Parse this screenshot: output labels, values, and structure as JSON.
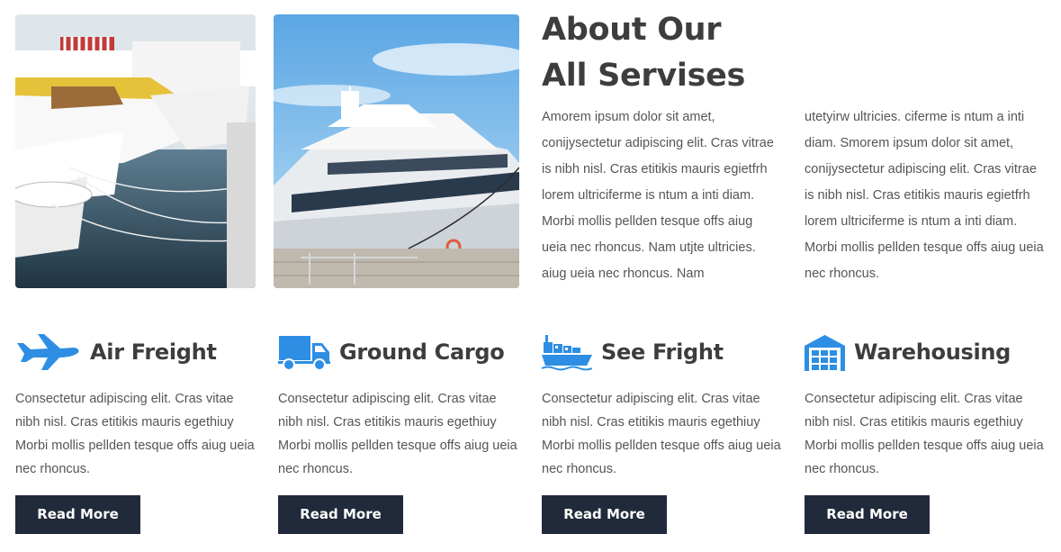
{
  "about": {
    "title_line1": "About Our",
    "title_line2": "All Servises",
    "column1": "Amorem ipsum dolor sit amet, conijysectetur adipiscing elit. Cras vitrae is nibh nisl. Cras etitikis mauris egietfrh lorem ultriciferme is ntum a inti diam. Morbi mollis pellden tesque offs aiug ueia nec rhoncus. Nam utjte ultricies. aiug ueia nec rhoncus. Nam",
    "column2": "utetyirw ultricies. ciferme is ntum a inti diam. Smorem ipsum dolor sit amet, conijysectetur adipiscing elit. Cras vitrae is nibh nisl. Cras etitikis mauris egietfrh lorem ultriciferme is ntum a inti diam. Morbi mollis pellden tesque offs aiug ueia nec rhoncus."
  },
  "images": {
    "photo1": "marina-boats-photo",
    "photo2": "yacht-at-dock-photo"
  },
  "colors": {
    "accent": "#2d8ee3",
    "heading": "#3d3d3d",
    "button": "#212a3a",
    "text": "#555555"
  },
  "services": [
    {
      "icon": "airplane-icon",
      "title": "Air Freight",
      "description": "Consectetur adipiscing elit. Cras vitae nibh nisl. Cras etitikis mauris egethiuy Morbi mollis pellden tesque offs aiug ueia nec rhoncus.",
      "button": "Read More"
    },
    {
      "icon": "truck-icon",
      "title": "Ground Cargo",
      "description": "Consectetur adipiscing elit. Cras vitae nibh nisl. Cras etitikis mauris egethiuy Morbi mollis pellden tesque offs aiug ueia nec rhoncus.",
      "button": "Read More"
    },
    {
      "icon": "cargo-ship-icon",
      "title": "See Fright",
      "description": "Consectetur adipiscing elit. Cras vitae nibh nisl. Cras etitikis mauris egethiuy Morbi mollis pellden tesque offs aiug ueia nec rhoncus.",
      "button": "Read More"
    },
    {
      "icon": "warehouse-icon",
      "title": "Warehousing",
      "description": "Consectetur adipiscing elit. Cras vitae nibh nisl. Cras etitikis mauris egethiuy Morbi mollis pellden tesque offs aiug ueia nec rhoncus.",
      "button": "Read More"
    }
  ]
}
